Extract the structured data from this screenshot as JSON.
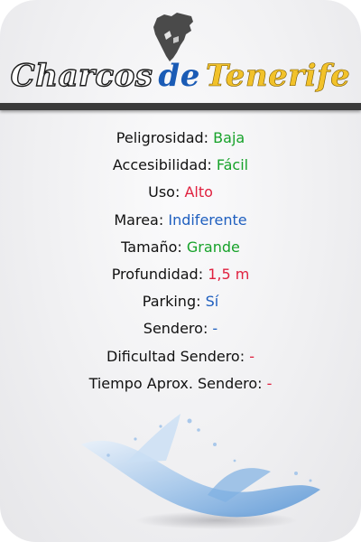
{
  "header": {
    "logo_icon": "tenerife-island-icon",
    "title_part1": "Charcos",
    "title_part2": "de",
    "title_part3": "Tenerife"
  },
  "details": [
    {
      "label": "Peligrosidad:",
      "value": "Baja",
      "color": "green"
    },
    {
      "label": "Accesibilidad:",
      "value": "Fácil",
      "color": "green"
    },
    {
      "label": "Uso:",
      "value": "Alto",
      "color": "red"
    },
    {
      "label": "Marea:",
      "value": "Indiferente",
      "color": "blue"
    },
    {
      "label": "Tamaño:",
      "value": "Grande",
      "color": "green"
    },
    {
      "label": "Profundidad:",
      "value": "1,5 m",
      "color": "red"
    },
    {
      "label": "Parking:",
      "value": "Sí",
      "color": "blue"
    },
    {
      "label": "Sendero:",
      "value": "-",
      "color": "blue"
    },
    {
      "label": "Dificultad Sendero:",
      "value": "-",
      "color": "red"
    },
    {
      "label": "Tiempo Aprox. Sendero:",
      "value": "-",
      "color": "red"
    }
  ],
  "decoration": {
    "splash_icon": "water-splash-icon"
  },
  "colors": {
    "green": "#17a22a",
    "red": "#e0213f",
    "blue": "#1f5fbf",
    "title_blue": "#1a5bb5",
    "title_yellow": "#f2c22a"
  }
}
